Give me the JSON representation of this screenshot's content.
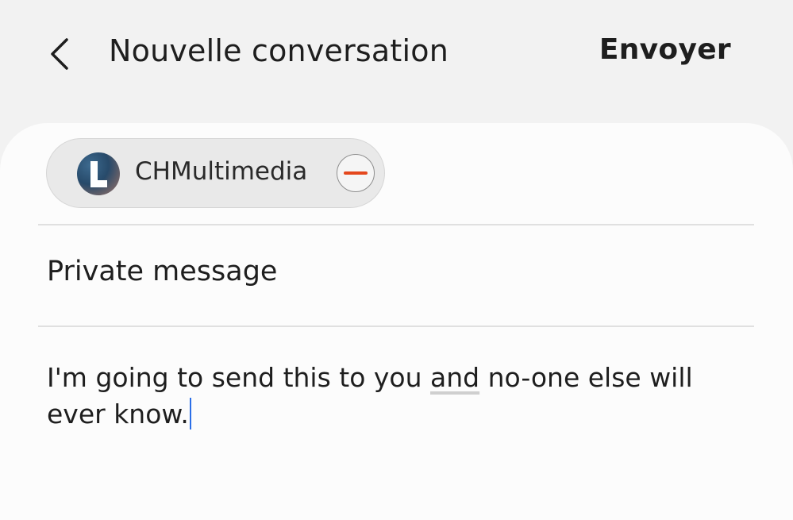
{
  "header": {
    "back_icon": "chevron-left-icon",
    "title": "Nouvelle conversation",
    "send_label": "Envoyer"
  },
  "recipient": {
    "avatar_letter": "L",
    "name": "CHMultimedia",
    "remove_icon": "minus-circle-icon",
    "remove_color": "#e4471d"
  },
  "subject": {
    "value": "Private message"
  },
  "message": {
    "text_before": "I'm going to send this to you ",
    "underlined_word": "and",
    "text_after": " no-one else will ever know."
  },
  "colors": {
    "caret": "#2b6fe8",
    "background": "#f2f2f2",
    "card": "#fcfcfc"
  }
}
